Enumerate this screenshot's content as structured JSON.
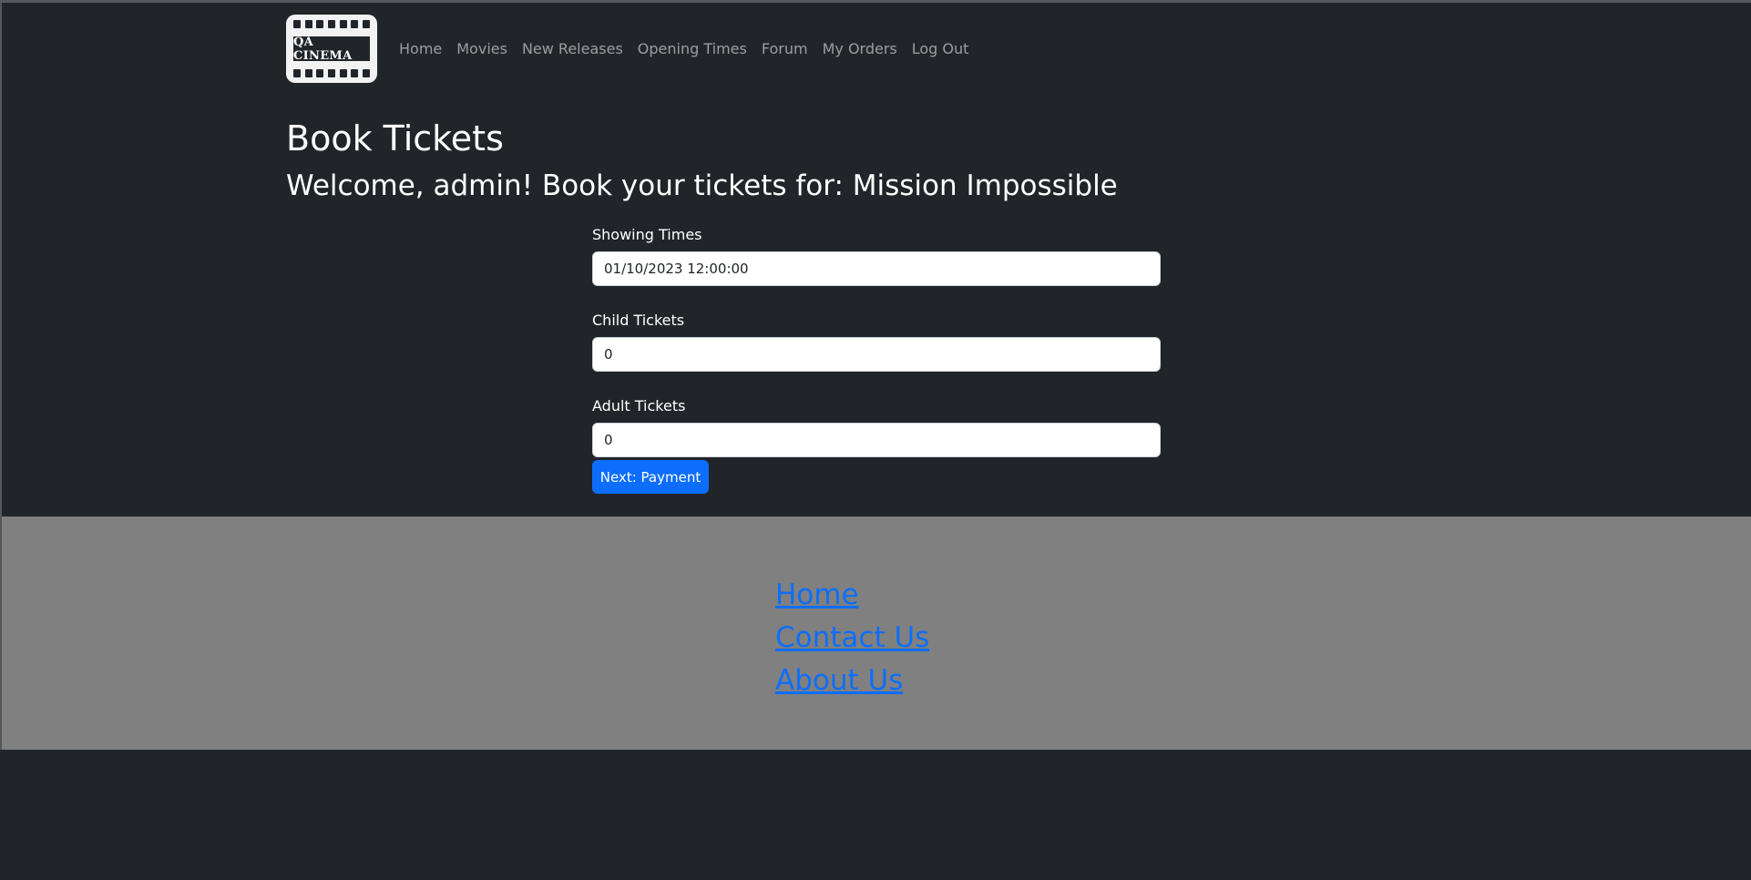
{
  "brand": {
    "logo_text": "QA CINEMA"
  },
  "nav": {
    "items": [
      {
        "label": "Home"
      },
      {
        "label": "Movies"
      },
      {
        "label": "New Releases"
      },
      {
        "label": "Opening Times"
      },
      {
        "label": "Forum"
      },
      {
        "label": "My Orders"
      },
      {
        "label": "Log Out"
      }
    ]
  },
  "page": {
    "title": "Book Tickets",
    "subtitle": "Welcome, admin! Book your tickets for: Mission Impossible"
  },
  "form": {
    "showing_times": {
      "label": "Showing Times",
      "value": "01/10/2023 12:00:00"
    },
    "child_tickets": {
      "label": "Child Tickets",
      "value": "0"
    },
    "adult_tickets": {
      "label": "Adult Tickets",
      "value": "0"
    },
    "submit_label": "Next: Payment"
  },
  "footer": {
    "links": [
      {
        "label": "Home"
      },
      {
        "label": "Contact Us"
      },
      {
        "label": "About Us"
      }
    ]
  },
  "colors": {
    "background": "#212529",
    "footer_background": "#808080",
    "primary": "#0d6efd"
  }
}
